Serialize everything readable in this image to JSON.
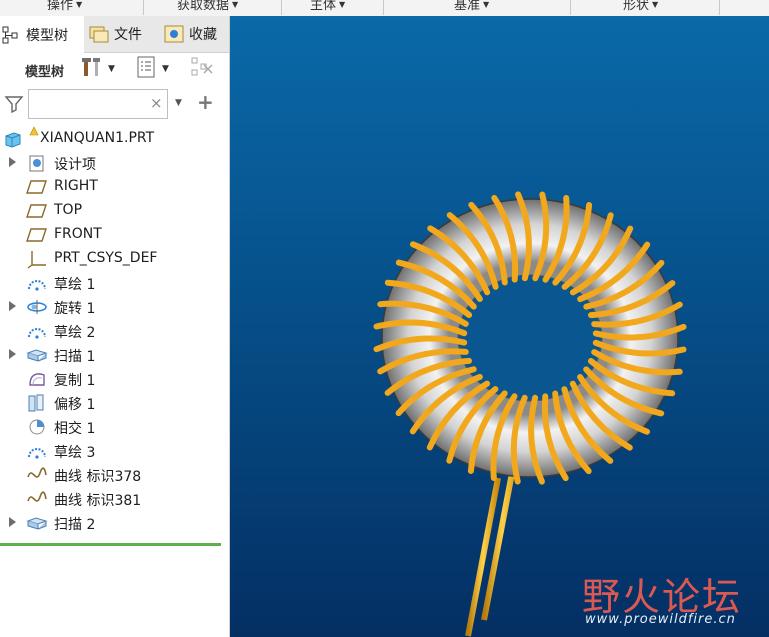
{
  "ribbon": {
    "groups": [
      "操作",
      "获取数据",
      "主体",
      "基准",
      "形状"
    ]
  },
  "tabs": [
    {
      "label": "模型树",
      "icon": "model-tree-icon"
    },
    {
      "label": "文件",
      "icon": "folder-icon"
    },
    {
      "label": "收藏",
      "icon": "favorites-icon"
    }
  ],
  "toolbar": {
    "tree_label": "模型树",
    "settings_icon": "tools-icon",
    "columns_icon": "list-columns-icon",
    "display_icon": "tree-display-icon"
  },
  "filter": {
    "value": "",
    "placeholder": "",
    "clear": "×",
    "add": "+"
  },
  "tree": {
    "root": "XIANQUAN1.PRT",
    "items": [
      {
        "label": "设计项",
        "icon": "design-items-icon",
        "expandable": true
      },
      {
        "label": "RIGHT",
        "icon": "datum-plane-icon",
        "expandable": false
      },
      {
        "label": "TOP",
        "icon": "datum-plane-icon",
        "expandable": false
      },
      {
        "label": "FRONT",
        "icon": "datum-plane-icon",
        "expandable": false
      },
      {
        "label": "PRT_CSYS_DEF",
        "icon": "csys-icon",
        "expandable": false
      },
      {
        "label": "草绘 1",
        "icon": "sketch-icon",
        "expandable": false
      },
      {
        "label": "旋转 1",
        "icon": "revolve-icon",
        "expandable": true
      },
      {
        "label": "草绘 2",
        "icon": "sketch-icon",
        "expandable": false
      },
      {
        "label": "扫描 1",
        "icon": "sweep-icon",
        "expandable": true
      },
      {
        "label": "复制 1",
        "icon": "copy-icon",
        "expandable": false
      },
      {
        "label": "偏移 1",
        "icon": "offset-icon",
        "expandable": false
      },
      {
        "label": "相交 1",
        "icon": "intersect-icon",
        "expandable": false
      },
      {
        "label": "草绘 3",
        "icon": "sketch-icon",
        "expandable": false
      },
      {
        "label": "曲线 标识378",
        "icon": "curve-icon",
        "expandable": false
      },
      {
        "label": "曲线 标识381",
        "icon": "curve-icon",
        "expandable": false
      },
      {
        "label": "扫描 2",
        "icon": "sweep-icon",
        "expandable": true
      }
    ]
  },
  "watermark": {
    "text": "野火论坛",
    "url": "www.proewildfire.cn"
  },
  "colors": {
    "viewport_top": "#0a69a8",
    "viewport_bottom": "#042f63",
    "coil": "#f2a81d",
    "accent_green": "#5fb04a"
  }
}
